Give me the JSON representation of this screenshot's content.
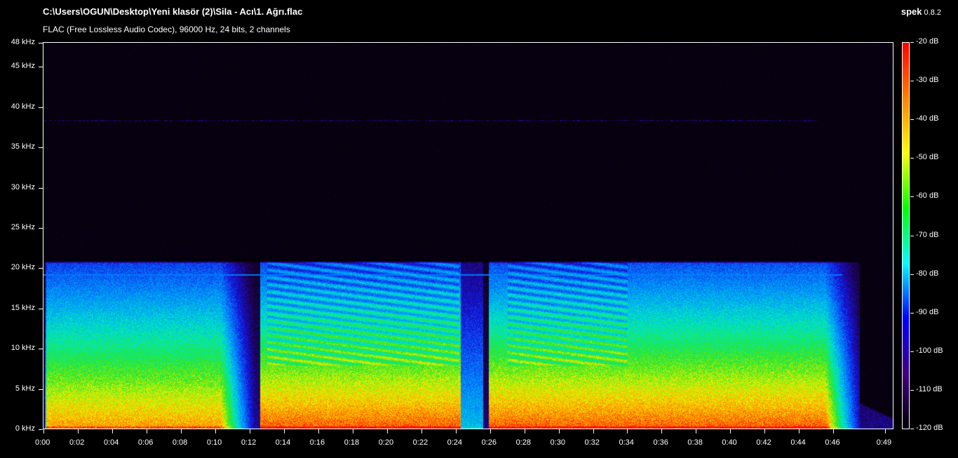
{
  "header": {
    "file_path": "C:\\Users\\OGUN\\Desktop\\Yeni klasör (2)\\Sila - Acı\\1. Ağrı.flac",
    "format_info": "FLAC (Free Lossless Audio Codec), 96000 Hz, 24 bits, 2 channels"
  },
  "brand": {
    "name": "spek",
    "version": "0.8.2"
  },
  "frequency_axis": {
    "labels": [
      "0 kHz",
      "5 kHz",
      "10 kHz",
      "15 kHz",
      "20 kHz",
      "25 kHz",
      "30 kHz",
      "35 kHz",
      "40 kHz",
      "45 kHz",
      "48 kHz"
    ],
    "values_khz": [
      0,
      5,
      10,
      15,
      20,
      25,
      30,
      35,
      40,
      45,
      48
    ],
    "max_khz": 48
  },
  "time_axis": {
    "labels": [
      "0:00",
      "0:02",
      "0:04",
      "0:06",
      "0:08",
      "0:10",
      "0:12",
      "0:14",
      "0:16",
      "0:18",
      "0:20",
      "0:22",
      "0:24",
      "0:26",
      "0:28",
      "0:30",
      "0:32",
      "0:34",
      "0:36",
      "0:38",
      "0:40",
      "0:42",
      "0:44",
      "0:46",
      "0:49"
    ],
    "values_s": [
      0,
      2,
      4,
      6,
      8,
      10,
      12,
      14,
      16,
      18,
      20,
      22,
      24,
      26,
      28,
      30,
      32,
      34,
      36,
      38,
      40,
      42,
      44,
      46,
      49
    ],
    "duration_s": 49.5
  },
  "db_scale": {
    "labels": [
      "-20 dB",
      "-30 dB",
      "-40 dB",
      "-50 dB",
      "-60 dB",
      "-70 dB",
      "-80 dB",
      "-90 dB",
      "-100 dB",
      "-110 dB",
      "-120 dB"
    ],
    "values_db": [
      -20,
      -30,
      -40,
      -50,
      -60,
      -70,
      -80,
      -90,
      -100,
      -110,
      -120
    ],
    "colors": [
      "#ff0000",
      "#ff8000",
      "#ffff00",
      "#00ff00",
      "#00ffff",
      "#0000ff",
      "#40007f",
      "#000000"
    ]
  }
}
